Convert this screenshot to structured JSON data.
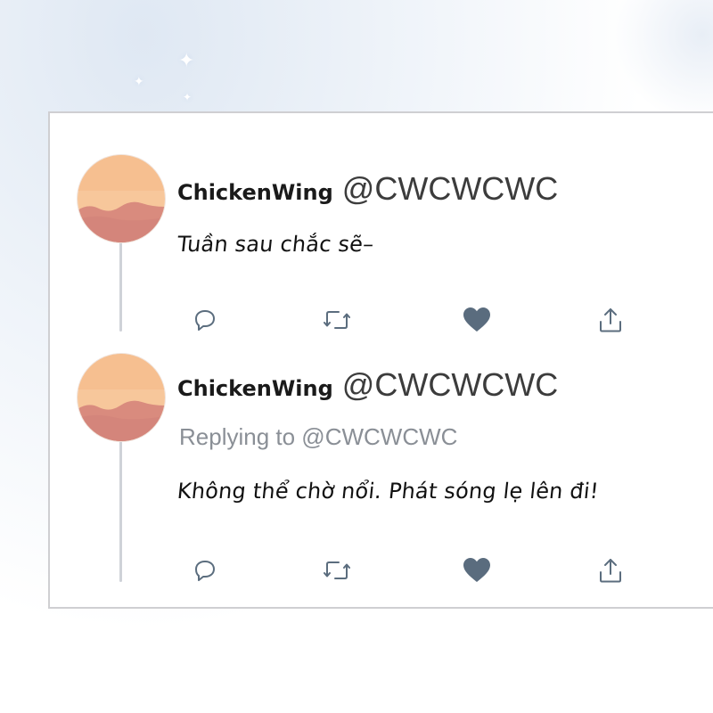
{
  "tweets": [
    {
      "display_name": "ChickenWing",
      "handle": "@CWCWCWC",
      "reply_to": "",
      "text": "Tuần sau chắc sẽ–",
      "liked": true,
      "actions": [
        "reply-icon",
        "retweet-icon",
        "heart-icon",
        "share-icon"
      ]
    },
    {
      "display_name": "ChickenWing",
      "handle": "@CWCWCWC",
      "reply_to": "Replying to @CWCWCWC",
      "text": "Không thể chờ nổi. Phát sóng lẹ lên đi!",
      "liked": true,
      "actions": [
        "reply-icon",
        "retweet-icon",
        "heart-icon",
        "share-icon"
      ]
    }
  ],
  "colors": {
    "icon": "#5b6d7e",
    "heart": "#5a6c7e",
    "avatar_sky": "#f7c79b",
    "avatar_ground": "#d98b7e",
    "thread_line": "#cfd2d8"
  }
}
